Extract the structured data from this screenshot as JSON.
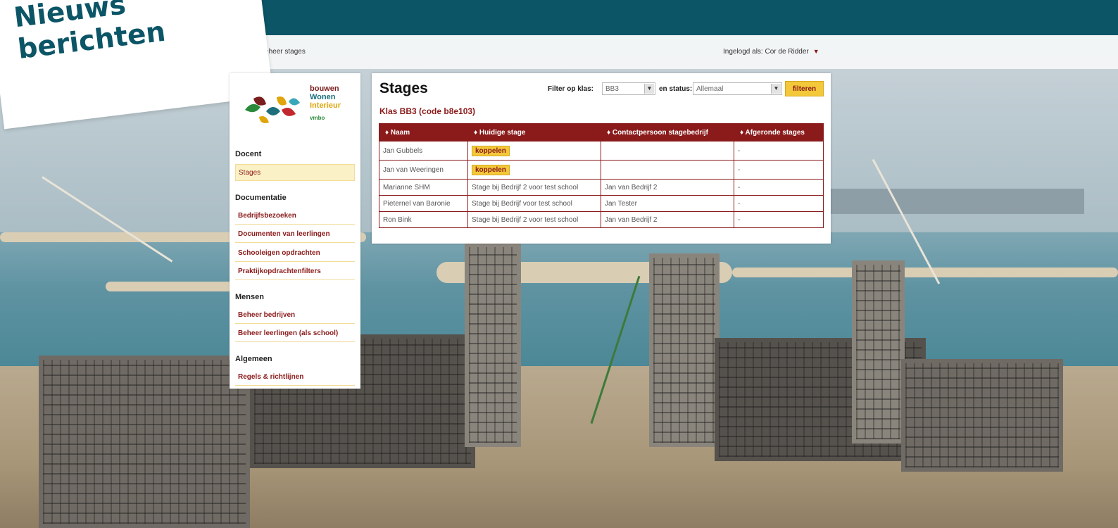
{
  "news": {
    "title_line1": "Nieuws",
    "title_line2": "berichten"
  },
  "breadcrumb": "» Beheer stages",
  "login": {
    "text": "Ingelogd als: Cor de Ridder",
    "caret": "▼"
  },
  "logo": {
    "line1": "bouwen",
    "line2": "Wonen",
    "line3": "Interieur",
    "line4": "vmbo"
  },
  "sidebar": {
    "sections": [
      {
        "title": "Docent",
        "items": [
          "Stages"
        ]
      },
      {
        "title": "Documentatie",
        "items": [
          "Bedrijfsbezoeken",
          "Documenten van leerlingen",
          "Schooleigen opdrachten",
          "Praktijkopdrachtenfilters"
        ]
      },
      {
        "title": "Mensen",
        "items": [
          "Beheer bedrijven",
          "Beheer leerlingen (als school)"
        ]
      },
      {
        "title": "Algemeen",
        "items": [
          "Regels & richtlijnen"
        ]
      }
    ],
    "active_item": "Stages"
  },
  "main": {
    "title": "Stages",
    "subtitle": "Klas BB3 (code b8e103)",
    "filter": {
      "class_label": "Filter op klas:",
      "class_value": "BB3",
      "status_label": "en status:",
      "status_value": "Allemaal",
      "button_label": "filteren"
    },
    "table": {
      "headers": [
        "♦ Naam",
        "♦ Huidige stage",
        "♦ Contactpersoon stagebedrijf",
        "♦ Afgeronde stages"
      ],
      "rows": [
        [
          "Jan Gubbels",
          "koppelen",
          "",
          "-"
        ],
        [
          "Jan van Weeringen",
          "koppelen",
          "",
          "-"
        ],
        [
          "Marianne SHM",
          "Stage bij Bedrijf 2 voor test school",
          "Jan van Bedrijf 2",
          "-"
        ],
        [
          "Pieternel van Baronie",
          "Stage bij Bedrijf voor test school",
          "Jan Tester",
          "-"
        ],
        [
          "Ron Bink",
          "Stage bij Bedrijf 2 voor test school",
          "Jan van Bedrijf 2",
          "-"
        ]
      ]
    }
  },
  "colors": {
    "topbar": "#0b5566",
    "accent": "#8b1a1a",
    "button": "#f3c83a"
  }
}
